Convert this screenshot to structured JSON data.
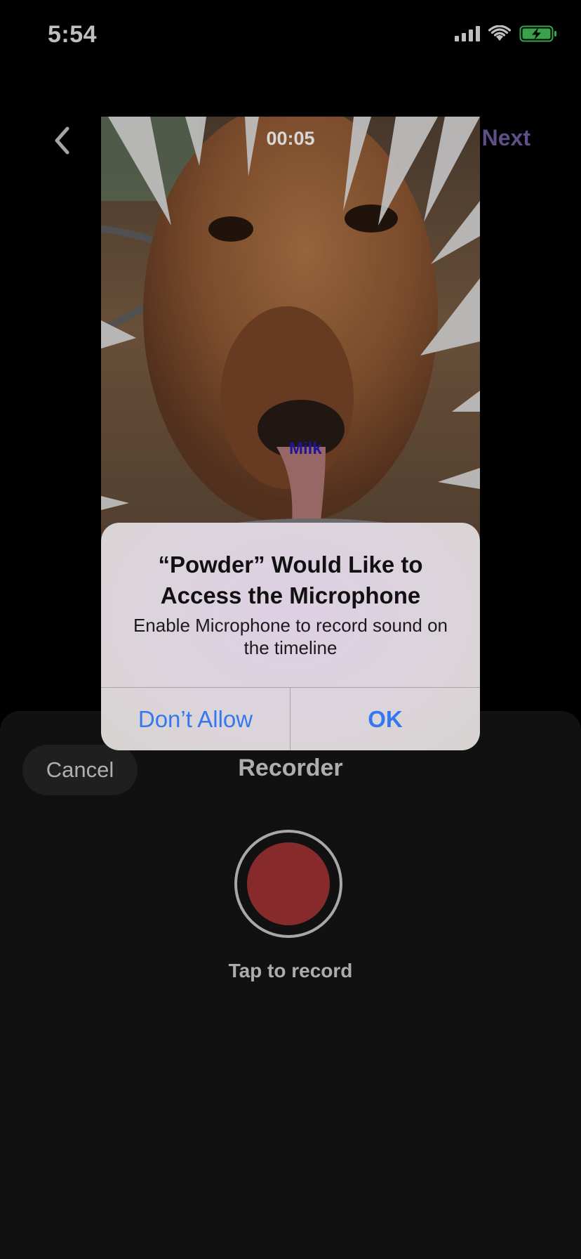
{
  "status_bar": {
    "time": "5:54"
  },
  "nav": {
    "timer": "00:05",
    "next_label": "Next"
  },
  "video": {
    "sticker_text": "Milk"
  },
  "alert": {
    "title": "“Powder” Would Like to Access the Microphone",
    "message": "Enable Microphone to record sound on the timeline",
    "deny_label": "Don’t Allow",
    "ok_label": "OK"
  },
  "recorder": {
    "cancel_label": "Cancel",
    "title": "Recorder",
    "tap_label": "Tap to record"
  },
  "colors": {
    "accent_purple": "#7d6bb4",
    "record_red": "#b5383a",
    "ios_blue": "#3478f0",
    "battery_green": "#4cd964"
  }
}
